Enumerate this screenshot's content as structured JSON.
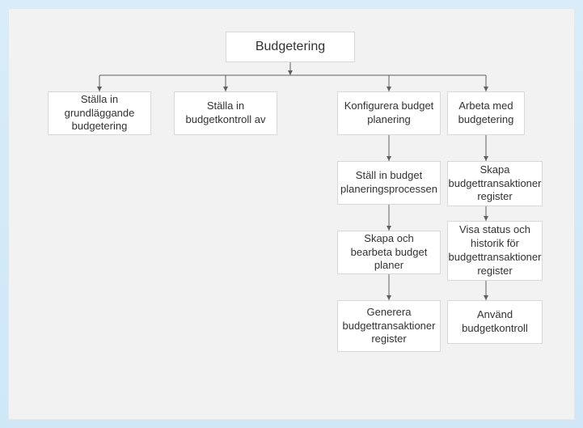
{
  "diagram": {
    "root": "Budgetering",
    "branches": [
      {
        "label": "Ställa in grundläggande budgetering",
        "children": []
      },
      {
        "label": "Ställa in budgetkontroll av",
        "children": []
      },
      {
        "label": "Konfigurera budget planering",
        "children": [
          "Ställ in budget planeringsprocessen",
          "Skapa och bearbeta budget planer",
          "Generera budgettransaktioner register"
        ]
      },
      {
        "label": "Arbeta med budgetering",
        "children": [
          "Skapa budgettransaktioner register",
          "Visa status och historik för budgettransaktioner register",
          "Använd budgetkontroll"
        ]
      }
    ]
  },
  "chart_data": {
    "type": "tree",
    "title": "Budgetering",
    "root": "Budgetering",
    "children": [
      {
        "name": "Ställa in grundläggande budgetering"
      },
      {
        "name": "Ställa in budgetkontroll av"
      },
      {
        "name": "Konfigurera budget planering",
        "children": [
          {
            "name": "Ställ in budget planeringsprocessen",
            "children": [
              {
                "name": "Skapa och bearbeta budget planer",
                "children": [
                  {
                    "name": "Generera budgettransaktioner register"
                  }
                ]
              }
            ]
          }
        ]
      },
      {
        "name": "Arbeta med budgetering",
        "children": [
          {
            "name": "Skapa budgettransaktioner register",
            "children": [
              {
                "name": "Visa status och historik för budgettransaktioner register",
                "children": [
                  {
                    "name": "Använd budgetkontroll"
                  }
                ]
              }
            ]
          }
        ]
      }
    ]
  }
}
